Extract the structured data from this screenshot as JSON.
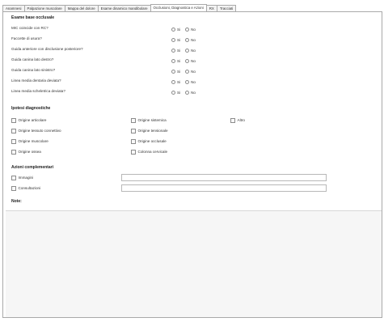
{
  "tabs": [
    {
      "label": "Anamnesi",
      "active": false
    },
    {
      "label": "Palpazione muscolare",
      "active": false
    },
    {
      "label": "Mappa del dolore",
      "active": false
    },
    {
      "label": "Esame dinamico mandibolare",
      "active": false
    },
    {
      "label": "Occlusioni, Diagnostica e Azioni",
      "active": true
    },
    {
      "label": "RX",
      "active": false
    },
    {
      "label": "Tracciati",
      "active": false
    }
  ],
  "esame": {
    "title": "Esame base occlusale",
    "yes_label": "Si",
    "no_label": "No",
    "questions": [
      "MIC coincide con RC?",
      "Faccette di usura?",
      "Guida anteriore con disclusione posteriore?",
      "Guida canina lato destro?",
      "Guida canina lato sinistro?",
      "Linea media dentaria deviata?",
      "Linea media scheletrica deviata?"
    ]
  },
  "ipotesi": {
    "title": "Ipotesi diagnostiche",
    "col1": [
      "Origine articolare",
      "Origine tessuto connettivo",
      "Origine muscolare",
      "Origine ossea"
    ],
    "col2": [
      "Origine sistemica",
      "Origine tensionale",
      "Origine occlusale",
      "Colonna cervicale"
    ],
    "col3": [
      "Altro"
    ]
  },
  "azioni": {
    "title": "Azioni complementari",
    "items": [
      "Immagini",
      "Consultazioni"
    ]
  },
  "note": {
    "title": "Note:"
  }
}
